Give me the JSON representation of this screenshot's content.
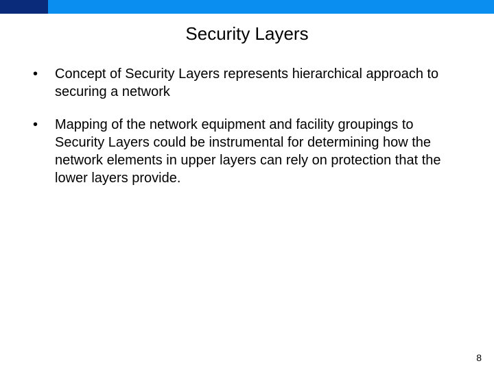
{
  "slide": {
    "title": "Security Layers",
    "bullets": [
      "Concept of Security Layers represents hierarchical approach to securing a network",
      "Mapping of the network equipment and facility groupings to Security Layers could be instrumental for determining how the network elements in upper layers can rely on protection that the lower layers provide."
    ],
    "page_number": "8"
  }
}
